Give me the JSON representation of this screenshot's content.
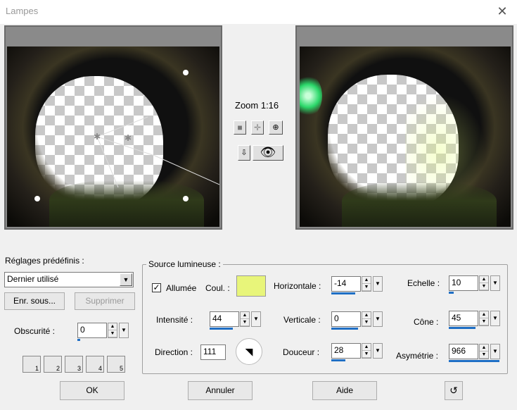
{
  "window": {
    "title": "Lampes"
  },
  "preview": {
    "zoom_label": "Zoom 1:16"
  },
  "presets": {
    "label": "Réglages prédéfinis :",
    "selected": "Dernier utilisé",
    "save_as": "Enr. sous...",
    "delete": "Supprimer",
    "darkness_label": "Obscurité :",
    "darkness_value": "0",
    "slots": [
      "1",
      "2",
      "3",
      "4",
      "5"
    ]
  },
  "light_source": {
    "group_label": "Source lumineuse :",
    "lit_label": "Allumée",
    "lit_checked": true,
    "color_label": "Coul. :",
    "color_value": "#e8f57a",
    "intensity_label": "Intensité :",
    "intensity_value": "44",
    "intensity_level": 0.44,
    "direction_label": "Direction :",
    "direction_value": "111",
    "horizontal_label": "Horizontale :",
    "horizontal_value": "-14",
    "vertical_label": "Verticale :",
    "vertical_value": "0",
    "softness_label": "Douceur :",
    "softness_value": "28",
    "scale_label": "Echelle :",
    "scale_value": "10",
    "cone_label": "Cône :",
    "cone_value": "45",
    "asymmetry_label": "Asymétrie :",
    "asymmetry_value": "966"
  },
  "buttons": {
    "ok": "OK",
    "cancel": "Annuler",
    "help": "Aide"
  }
}
